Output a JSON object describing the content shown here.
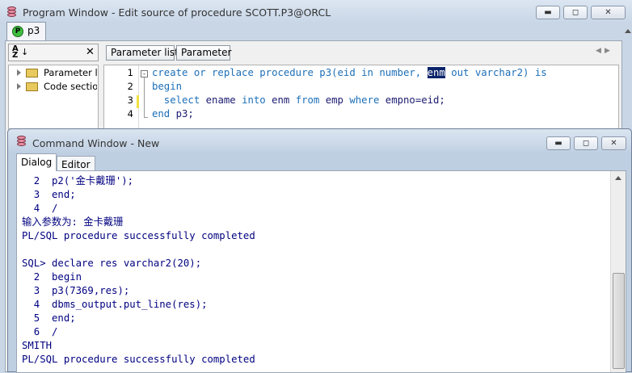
{
  "program_window": {
    "title": "Program Window - Edit source of procedure SCOTT.P3@ORCL",
    "tab_label": "p3",
    "sort_icon_label": "A↓Z",
    "close_glyph": "✕",
    "tree_items": [
      "Parameter lis",
      "Code sectior"
    ],
    "tab_buttons": [
      "Parameter list",
      "Parameter"
    ],
    "gutter_numbers": [
      "1",
      "2",
      "3",
      "4"
    ],
    "code_lines": [
      {
        "parts": [
          {
            "t": "create or replace procedure ",
            "c": "kw"
          },
          {
            "t": "p3(eid ",
            "c": "kwo"
          },
          {
            "t": "in number",
            "c": "kw"
          },
          {
            "t": ", ",
            "c": "kw"
          },
          {
            "t": "enm",
            "c": "sel"
          },
          {
            "t": " out varchar2) is",
            "c": "kw"
          }
        ]
      },
      {
        "parts": [
          {
            "t": "begin",
            "c": "kw"
          }
        ]
      },
      {
        "parts": [
          {
            "t": "  select ",
            "c": "kw"
          },
          {
            "t": "ename ",
            "c": "plain"
          },
          {
            "t": "into ",
            "c": "kw"
          },
          {
            "t": "enm ",
            "c": "plain"
          },
          {
            "t": "from ",
            "c": "kw"
          },
          {
            "t": "emp ",
            "c": "plain"
          },
          {
            "t": "where ",
            "c": "kw"
          },
          {
            "t": "empno=eid;",
            "c": "plain"
          }
        ]
      },
      {
        "parts": [
          {
            "t": "end ",
            "c": "kw"
          },
          {
            "t": "p3;",
            "c": "plain"
          }
        ]
      }
    ]
  },
  "command_window": {
    "title": "Command Window - New",
    "tabs": [
      "Dialog",
      "Editor"
    ],
    "lines": [
      {
        "text": "  2  p2('金卡戴珊');",
        "color": "#000080"
      },
      {
        "text": "  3  end;",
        "color": "#000080"
      },
      {
        "text": "  4  /",
        "color": "#000080"
      },
      {
        "text": "输入参数为: 金卡戴珊",
        "color": "#000080"
      },
      {
        "text": "PL/SQL procedure successfully completed",
        "color": "#000080"
      },
      {
        "text": "",
        "color": "#000080"
      },
      {
        "text": "SQL> declare res varchar2(20);",
        "color": "#000080"
      },
      {
        "text": "  2  begin",
        "color": "#000080"
      },
      {
        "text": "  3  p3(7369,res);",
        "color": "#000080"
      },
      {
        "text": "  4  dbms_output.put_line(res);",
        "color": "#000080"
      },
      {
        "text": "  5  end;",
        "color": "#000080"
      },
      {
        "text": "  6  /",
        "color": "#000080"
      },
      {
        "text": "SMITH",
        "color": "#000080"
      },
      {
        "text": "PL/SQL procedure successfully completed",
        "color": "#000080"
      }
    ]
  },
  "colors": {
    "keyword": "#1c6fb8",
    "plain": "#1a1a70",
    "selection_bg": "#0a246a",
    "output_text": "#000080"
  }
}
